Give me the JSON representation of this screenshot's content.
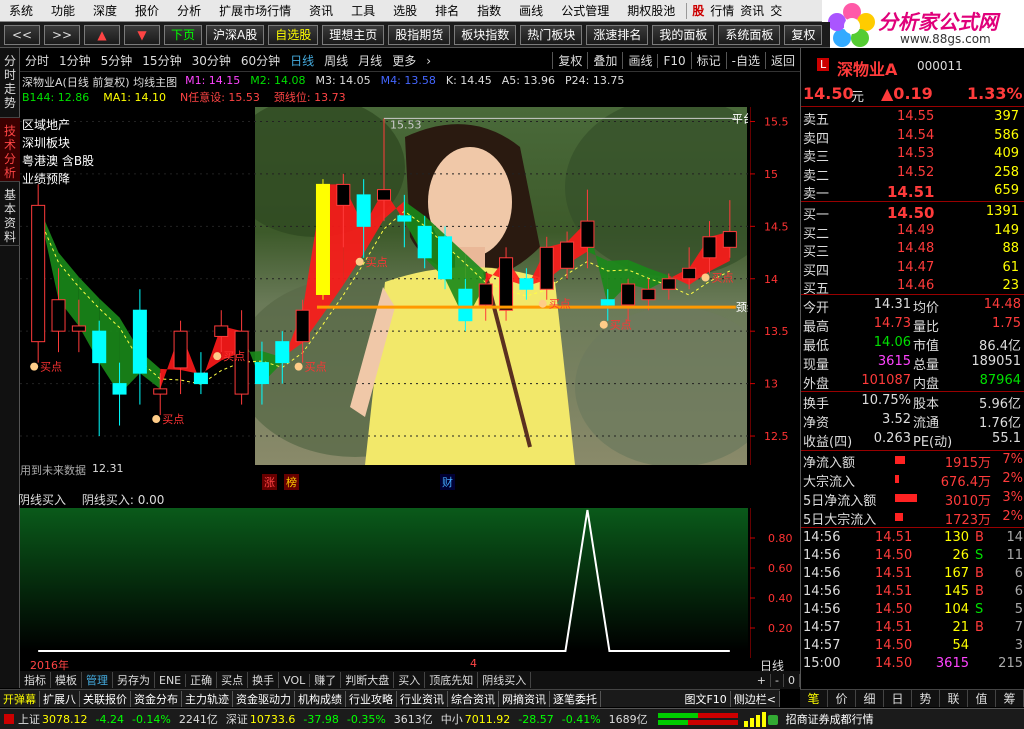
{
  "menubar": {
    "items": [
      "系统",
      "功能",
      "深度",
      "报价",
      "分析",
      "扩展市场行情",
      "资讯",
      "工具",
      "选股",
      "排名",
      "指数",
      "画线",
      "公式管理",
      "期权股池"
    ],
    "right_items": [
      "股",
      "行情",
      "资讯",
      "交"
    ]
  },
  "logo": {
    "title": "分析家公式网",
    "url": "www.88gs.com"
  },
  "toolbar": {
    "buttons": [
      "<<",
      ">>",
      "▲",
      "▼",
      "下页",
      "沪深A股",
      "自选股",
      "理想主页",
      "股指期货",
      "板块指数",
      "热门板块",
      "涨速排名",
      "我的面板",
      "系统面板",
      "复权"
    ]
  },
  "sidetabs": [
    "分时走势",
    "技术分析",
    "基本资料"
  ],
  "periodbar": {
    "periods": [
      "分时",
      "1分钟",
      "5分钟",
      "15分钟",
      "30分钟",
      "60分钟",
      "日线",
      "周线",
      "月线",
      "更多"
    ],
    "selected": "日线",
    "right_buttons": [
      "复权",
      "叠加",
      "画线",
      "F10",
      "标记",
      "-自选",
      "返回"
    ]
  },
  "chart_title": "深物业A(日线 前复权) 均线主图",
  "indicators_row1": [
    {
      "label": "M1: 14.15",
      "color": "#ff44ff"
    },
    {
      "label": "M2: 14.08",
      "color": "#00e000"
    },
    {
      "label": "M3: 14.05",
      "color": "#dddddd"
    },
    {
      "label": "M4: 13.58",
      "color": "#4466ff"
    },
    {
      "label": "K: 14.45",
      "color": "#dddddd"
    },
    {
      "label": "A5: 13.96",
      "color": "#dddddd"
    },
    {
      "label": "P24: 13.75",
      "color": "#dddddd"
    }
  ],
  "indicators_row2": [
    {
      "label": "B144: 12.86",
      "color": "#00e000"
    },
    {
      "label": "MA1: 14.10",
      "color": "#ffff00"
    },
    {
      "label": "N任意设: 15.53",
      "color": "#ff4444"
    },
    {
      "label": "颈线位: 13.73",
      "color": "#ff4444"
    }
  ],
  "stock_info_lines": [
    "区域地产",
    "深圳板块",
    "粤港澳 含B股",
    "业绩预降"
  ],
  "chart_labels": {
    "peak_value": "15.53",
    "neckline": "颈线位",
    "top_level": "平台位",
    "low_value": "12.31",
    "bottom_note": "用到未来数据",
    "buy_point": "买点",
    "foot_markers": [
      "涨",
      "榜",
      "财"
    ]
  },
  "chart_data": {
    "type": "bar",
    "title": "深物业A(日线 前复权) 均线主图",
    "ylim": [
      12.3,
      15.6
    ],
    "yticks": [
      12.5,
      13.0,
      13.5,
      14.0,
      14.5,
      15.0,
      15.5
    ],
    "candles": [
      {
        "o": 13.4,
        "c": 14.7,
        "h": 14.9,
        "l": 13.2
      },
      {
        "o": 13.5,
        "c": 13.8,
        "h": 14.1,
        "l": 13.3
      },
      {
        "o": 13.5,
        "c": 13.55,
        "h": 13.8,
        "l": 13.3
      },
      {
        "o": 13.5,
        "c": 13.2,
        "h": 13.6,
        "l": 12.5
      },
      {
        "o": 13.0,
        "c": 12.9,
        "h": 13.2,
        "l": 12.6
      },
      {
        "o": 13.7,
        "c": 13.1,
        "h": 13.9,
        "l": 12.8
      },
      {
        "o": 12.9,
        "c": 12.95,
        "h": 13.1,
        "l": 12.7
      },
      {
        "o": 13.15,
        "c": 13.5,
        "h": 13.6,
        "l": 12.9
      },
      {
        "o": 13.1,
        "c": 13.0,
        "h": 13.3,
        "l": 12.9
      },
      {
        "o": 13.45,
        "c": 13.55,
        "h": 13.7,
        "l": 13.3
      },
      {
        "o": 12.9,
        "c": 13.5,
        "h": 13.7,
        "l": 12.8
      },
      {
        "o": 13.2,
        "c": 13.0,
        "h": 13.4,
        "l": 12.8
      },
      {
        "o": 13.4,
        "c": 13.2,
        "h": 13.5,
        "l": 13.0
      },
      {
        "o": 13.4,
        "c": 13.7,
        "h": 13.8,
        "l": 13.2
      },
      {
        "o": 13.85,
        "c": 14.9,
        "h": 14.95,
        "l": 13.8
      },
      {
        "o": 14.7,
        "c": 14.9,
        "h": 15.0,
        "l": 14.3
      },
      {
        "o": 14.8,
        "c": 14.5,
        "h": 14.95,
        "l": 14.2
      },
      {
        "o": 14.75,
        "c": 14.85,
        "h": 15.53,
        "l": 14.55
      },
      {
        "o": 14.6,
        "c": 14.55,
        "h": 14.8,
        "l": 14.3
      },
      {
        "o": 14.5,
        "c": 14.2,
        "h": 14.6,
        "l": 14.1
      },
      {
        "o": 14.4,
        "c": 14.0,
        "h": 14.5,
        "l": 13.9
      },
      {
        "o": 13.9,
        "c": 13.6,
        "h": 14.0,
        "l": 13.5
      },
      {
        "o": 13.75,
        "c": 13.95,
        "h": 14.0,
        "l": 13.6
      },
      {
        "o": 13.7,
        "c": 14.2,
        "h": 14.3,
        "l": 13.6
      },
      {
        "o": 14.0,
        "c": 13.9,
        "h": 14.1,
        "l": 13.8
      },
      {
        "o": 13.9,
        "c": 14.3,
        "h": 14.4,
        "l": 13.8
      },
      {
        "o": 14.1,
        "c": 14.35,
        "h": 14.45,
        "l": 14.0
      },
      {
        "o": 14.3,
        "c": 14.55,
        "h": 14.85,
        "l": 14.1
      },
      {
        "o": 13.8,
        "c": 13.75,
        "h": 13.9,
        "l": 13.6
      },
      {
        "o": 13.75,
        "c": 13.95,
        "h": 14.0,
        "l": 13.6
      },
      {
        "o": 13.8,
        "c": 13.9,
        "h": 14.0,
        "l": 13.7
      },
      {
        "o": 13.9,
        "c": 14.0,
        "h": 14.05,
        "l": 13.8
      },
      {
        "o": 14.0,
        "c": 14.1,
        "h": 14.3,
        "l": 13.9
      },
      {
        "o": 14.2,
        "c": 14.4,
        "h": 14.55,
        "l": 14.05
      },
      {
        "o": 14.3,
        "c": 14.45,
        "h": 14.75,
        "l": 14.2
      }
    ],
    "neckline_value": 13.73,
    "top_level_value": 15.53
  },
  "sub_indicator": {
    "title": "阴线买入",
    "value_label": "阴线买入: 0.00",
    "yticks": [
      "0.80",
      "0.60",
      "0.40",
      "0.20"
    ],
    "peak_index": 27,
    "bars": 35
  },
  "datebar": {
    "year": "2016年",
    "month": "4",
    "period": "日线"
  },
  "bottom_tabs": [
    "指标",
    "模板",
    "管理",
    "另存为",
    "ENE",
    "正确",
    "买点",
    "换手",
    "VOL",
    "赚了",
    "判断大盘",
    "买入",
    "顶底先知",
    "阴线买入"
  ],
  "bottom_tabs_selected": "管理",
  "bottom_tabs_right": [
    "+",
    "-",
    "0"
  ],
  "funcbar": [
    "开弹幕",
    "扩展八",
    "关联报价",
    "资金分布",
    "主力轨迹",
    "资金驱动力",
    "机构成绩",
    "行业攻略",
    "行业资讯",
    "综合资讯",
    "网摘资讯",
    "逐笔委托"
  ],
  "funcbar_right": [
    "图文F10",
    "侧边栏<"
  ],
  "quote": {
    "name": "深物业A",
    "code": "000011",
    "price": "14.50",
    "unit": "元",
    "change": "▲0.19",
    "change_pct": "1.33%",
    "sell": [
      {
        "label": "卖五",
        "price": "14.55",
        "vol": "397"
      },
      {
        "label": "卖四",
        "price": "14.54",
        "vol": "586"
      },
      {
        "label": "卖三",
        "price": "14.53",
        "vol": "409"
      },
      {
        "label": "卖二",
        "price": "14.52",
        "vol": "258"
      },
      {
        "label": "卖一",
        "price": "14.51",
        "vol": "659"
      }
    ],
    "buy": [
      {
        "label": "买一",
        "price": "14.50",
        "vol": "1391"
      },
      {
        "label": "买二",
        "price": "14.49",
        "vol": "149"
      },
      {
        "label": "买三",
        "price": "14.48",
        "vol": "88"
      },
      {
        "label": "买四",
        "price": "14.47",
        "vol": "61"
      },
      {
        "label": "买五",
        "price": "14.46",
        "vol": "23"
      }
    ],
    "stats": [
      {
        "l1": "今开",
        "v1": "14.31",
        "c1": "wht",
        "l2": "均价",
        "v2": "14.48",
        "c2": "red"
      },
      {
        "l1": "最高",
        "v1": "14.73",
        "c1": "red",
        "l2": "量比",
        "v2": "1.75",
        "c2": "red"
      },
      {
        "l1": "最低",
        "v1": "14.06",
        "c1": "grn",
        "l2": "市值",
        "v2": "86.4亿",
        "c2": "wht"
      },
      {
        "l1": "现量",
        "v1": "3615",
        "c1": "mag",
        "l2": "总量",
        "v2": "189051",
        "c2": "wht"
      },
      {
        "l1": "外盘",
        "v1": "101087",
        "c1": "red",
        "l2": "内盘",
        "v2": "87964",
        "c2": "grn"
      }
    ],
    "stats2": [
      {
        "l1": "换手",
        "v1": "10.75%",
        "l2": "股本",
        "v2": "5.96亿"
      },
      {
        "l1": "净资",
        "v1": "3.52",
        "l2": "流通",
        "v2": "1.76亿"
      },
      {
        "l1": "收益(四)",
        "v1": "0.263",
        "l2": "PE(动)",
        "v2": "55.1"
      }
    ],
    "flows": [
      {
        "label": "净流入额",
        "value": "1915万",
        "pct": "7%",
        "bar": 0.35
      },
      {
        "label": "大宗流入",
        "value": "676.4万",
        "pct": "2%",
        "bar": 0.15
      },
      {
        "label": "5日净流入额",
        "value": "3010万",
        "pct": "3%",
        "bar": 0.8
      },
      {
        "label": "5日大宗流入",
        "value": "1723万",
        "pct": "2%",
        "bar": 0.3
      }
    ],
    "ticks": [
      {
        "t": "14:56",
        "p": "14.51",
        "v": "130",
        "f": "B",
        "n": "14"
      },
      {
        "t": "14:56",
        "p": "14.50",
        "v": "26",
        "f": "S",
        "n": "11"
      },
      {
        "t": "14:56",
        "p": "14.51",
        "v": "167",
        "f": "B",
        "n": "6"
      },
      {
        "t": "14:56",
        "p": "14.51",
        "v": "145",
        "f": "B",
        "n": "6"
      },
      {
        "t": "14:56",
        "p": "14.50",
        "v": "104",
        "f": "S",
        "n": "5"
      },
      {
        "t": "14:57",
        "p": "14.51",
        "v": "21",
        "f": "B",
        "n": "7"
      },
      {
        "t": "14:57",
        "p": "14.50",
        "v": "54",
        "f": "",
        "n": "3"
      },
      {
        "t": "15:00",
        "p": "14.50",
        "v": "3615",
        "f": "",
        "n": "215"
      }
    ]
  },
  "right_tabs": [
    "笔",
    "价",
    "细",
    "日",
    "势",
    "联",
    "值",
    "筹"
  ],
  "statusbar": {
    "sh_label": "上证",
    "sh_val": "3078.12",
    "sh_chg": "-4.24",
    "sh_pct": "-0.14%",
    "sh_amt": "2241亿",
    "sz_label": "深证",
    "sz_val": "10733.6",
    "sz_chg": "-37.98",
    "sz_pct": "-0.35%",
    "sz_amt": "3613亿",
    "zx_label": "中小",
    "zx_val": "7011.92",
    "zx_chg": "-28.57",
    "zx_pct": "-0.41%",
    "zx_amt": "1689亿",
    "broker": "招商证券成都行情"
  }
}
